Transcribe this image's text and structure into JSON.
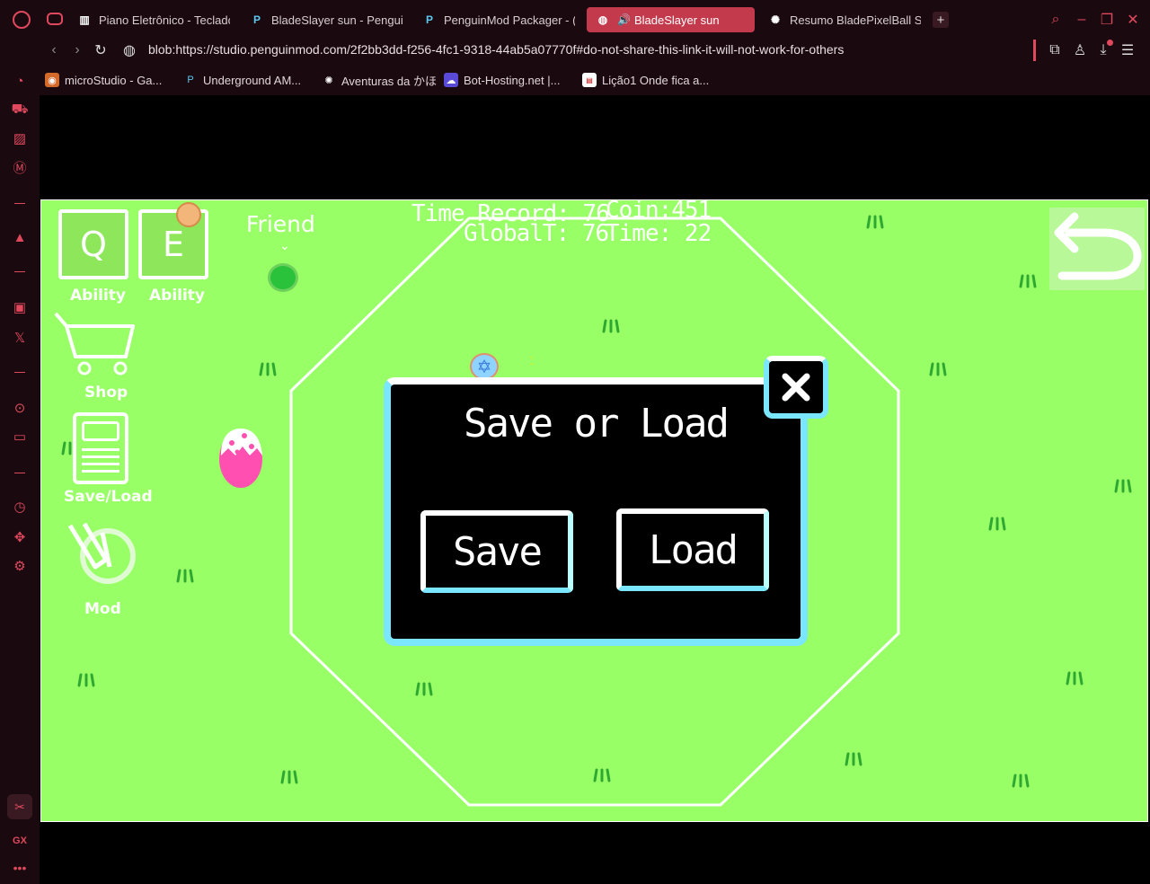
{
  "tabs": [
    {
      "label": "Piano Eletrônico - Teclado",
      "icon": "piano-icon"
    },
    {
      "label": "BladeSlayer sun - Pengui",
      "icon": "penguinmod-icon"
    },
    {
      "label": "PenguinMod Packager - (",
      "icon": "penguinmod-icon"
    },
    {
      "label": "BladeSlayer sun",
      "icon": "globe-icon",
      "active": true,
      "audio": true
    },
    {
      "label": "Resumo BladePixelBall Su",
      "icon": "chatgpt-icon"
    }
  ],
  "address": {
    "url": "blob:https://studio.penguinmod.com/2f2bb3dd-f256-4fc1-9318-44ab5a07770f#do-not-share-this-link-it-will-not-work-for-others"
  },
  "bookmarks": [
    {
      "label": "microStudio - Ga...",
      "icon": "microstudio-icon"
    },
    {
      "label": "Underground AM...",
      "icon": "penguinmod-icon"
    },
    {
      "label": "Aventuras da かほ",
      "icon": "chatgpt-icon"
    },
    {
      "label": "Bot-Hosting.net |...",
      "icon": "cloud-icon"
    },
    {
      "label": "Lição1 Onde fica a...",
      "icon": "page-icon"
    }
  ],
  "sidebar": {
    "gx_label": "GX"
  },
  "game": {
    "ability_q": {
      "key": "Q",
      "label": "Ability"
    },
    "ability_e": {
      "key": "E",
      "label": "Ability"
    },
    "friend_label": "Friend",
    "shop_label": "Shop",
    "saveload_label": "Save/Load",
    "mod_label": "Mod",
    "time_record": "Time Record: 76",
    "coin": "Coin:451",
    "global_time": "GlobalT: 76",
    "time": "Time: 22"
  },
  "dialog": {
    "title": "Save or Load",
    "save_label": "Save",
    "load_label": "Load"
  },
  "colors": {
    "accent": "#e0485e",
    "grass_bg": "#99ff66",
    "dialog_border": "#7be6ff"
  }
}
